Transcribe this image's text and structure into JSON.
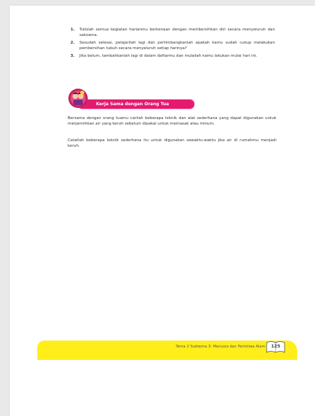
{
  "steps": [
    {
      "num": "1.",
      "text": "Tulislah semua kegiatan harianmu berkenaan dengan membersihkan diri secara menyeluruh dan saksama."
    },
    {
      "num": "2.",
      "text": "Sesudah selesai, pelajarilah lagi dan pertimbangkanlah apakah kamu sudah cukup melakukan pembersihan tubuh secara menyeluruh  setiap harinya?"
    },
    {
      "num": "3.",
      "text": "Jika belum, tambahkanlah lagi di dalam daftarmu dan mulailah kamu lakukan mulai hari ini."
    }
  ],
  "section": {
    "title": "Kerja Sama dengan Orang Tua",
    "accent_color": "#e6196f"
  },
  "paragraphs": {
    "p1": "Bersama dengan orang tuamu carilah beberapa teknik dan alat sederhana yang dapat digunakan untuk menjernihkan air yang keruh sebelum dipakai untuk memasak atau minum.",
    "p2": "Catatlah beberapa teknik sederhana itu untuk digunakan sewaktu-waktu jika air di rumahmu menjadi keruh."
  },
  "footer": {
    "theme_text": "Tema 2 Subtema 3: Manusia dan Peristiwa Alam",
    "page_number": "125",
    "band_color": "#ffee1a"
  }
}
